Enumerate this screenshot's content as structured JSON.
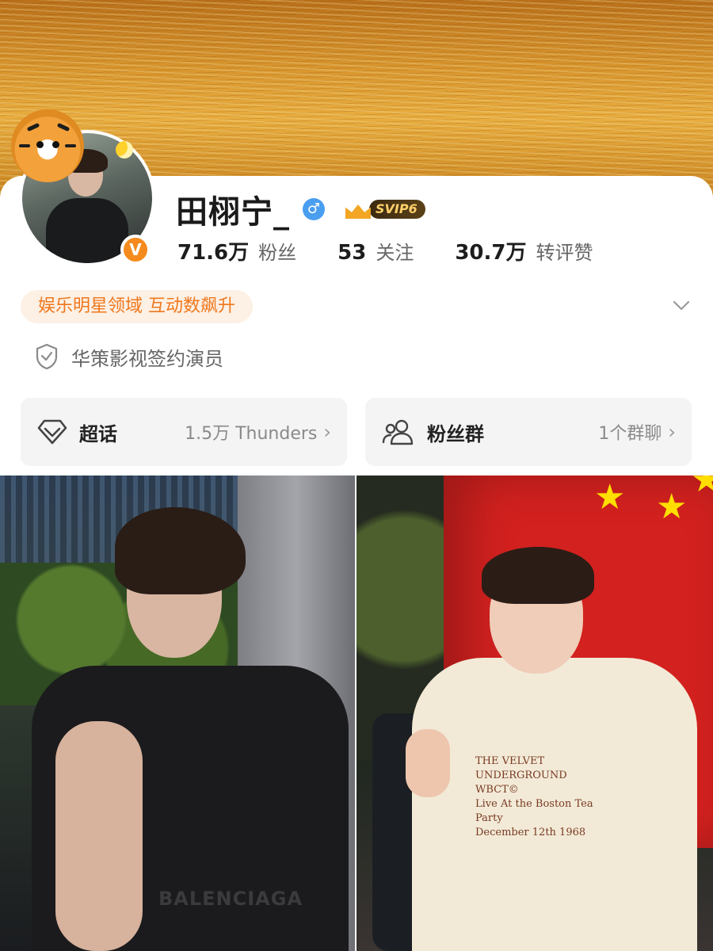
{
  "profile": {
    "name": "田栩宁_",
    "gender_symbol": "♂",
    "verify_mark": "V",
    "svip_label": "SVIP6",
    "stats": [
      {
        "value": "71.6万",
        "label": "粉丝"
      },
      {
        "value": "53",
        "label": "关注"
      },
      {
        "value": "30.7万",
        "label": "转评赞"
      }
    ],
    "tag": "娱乐明星领域 互动数飙升",
    "certification": "华策影视签约演员"
  },
  "pills": {
    "supertopic": {
      "title": "超话",
      "meta": "1.5万 Thunders",
      "arrow": "›"
    },
    "fan_group": {
      "title": "粉丝群",
      "meta": "1个群聊",
      "arrow": "›"
    }
  },
  "photos": {
    "left_shirt_text": "BALENCIAGA",
    "right_print_lines": [
      "THE VELVET UNDERGROUND",
      "WBCT©",
      "Live At the Boston Tea Party",
      "December 12th 1968"
    ]
  },
  "colors": {
    "accent_orange": "#f0771d",
    "verify_orange": "#f58b1c",
    "gender_blue": "#4a9ef0",
    "svip_gold": "#ffd06a"
  }
}
